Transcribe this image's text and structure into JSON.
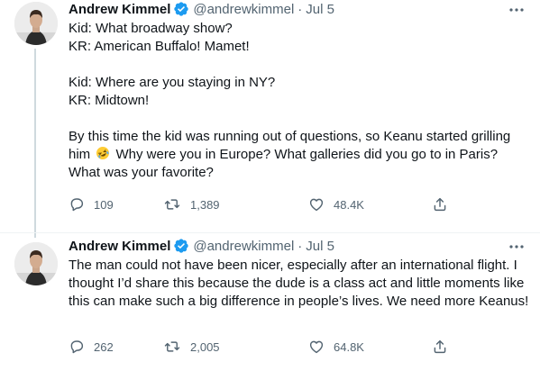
{
  "colors": {
    "verified_badge": "#1d9bf0",
    "secondary_text": "#536471",
    "primary_text": "#0f1419",
    "thread_line": "#cfd9de"
  },
  "tweets": [
    {
      "author_name": "Andrew Kimmel",
      "handle": "@andrewkimmel",
      "separator": "·",
      "date": "Jul 5",
      "verified_icon": "verified-badge-icon",
      "lines": {
        "l1": "Kid: What broadway show?",
        "l2": "KR: American Buffalo! Mamet!",
        "l3": "Kid: Where are you staying in NY?",
        "l4": "KR: Midtown!",
        "l5a": "By this time the kid was running out of questions, so Keanu started grilling him",
        "emoji": "rolling-on-floor-laughing-emoji",
        "l5b": " Why were you in Europe? What galleries did you go to in Paris? What was your favorite?"
      },
      "stats": {
        "replies": "109",
        "retweets": "1,389",
        "likes": "48.4K"
      }
    },
    {
      "author_name": "Andrew Kimmel",
      "handle": "@andrewkimmel",
      "separator": "·",
      "date": "Jul 5",
      "verified_icon": "verified-badge-icon",
      "text": "The man could not have been nicer, especially after an international flight. I thought I’d share this because the dude is a class act and little moments like this can make such a big difference in people’s lives. We need more Keanus!",
      "stats": {
        "replies": "262",
        "retweets": "2,005",
        "likes": "64.8K"
      }
    }
  ],
  "icons": {
    "reply": "reply-icon",
    "retweet": "retweet-icon",
    "like": "heart-icon",
    "share": "share-icon",
    "more": "more-options-icon"
  }
}
